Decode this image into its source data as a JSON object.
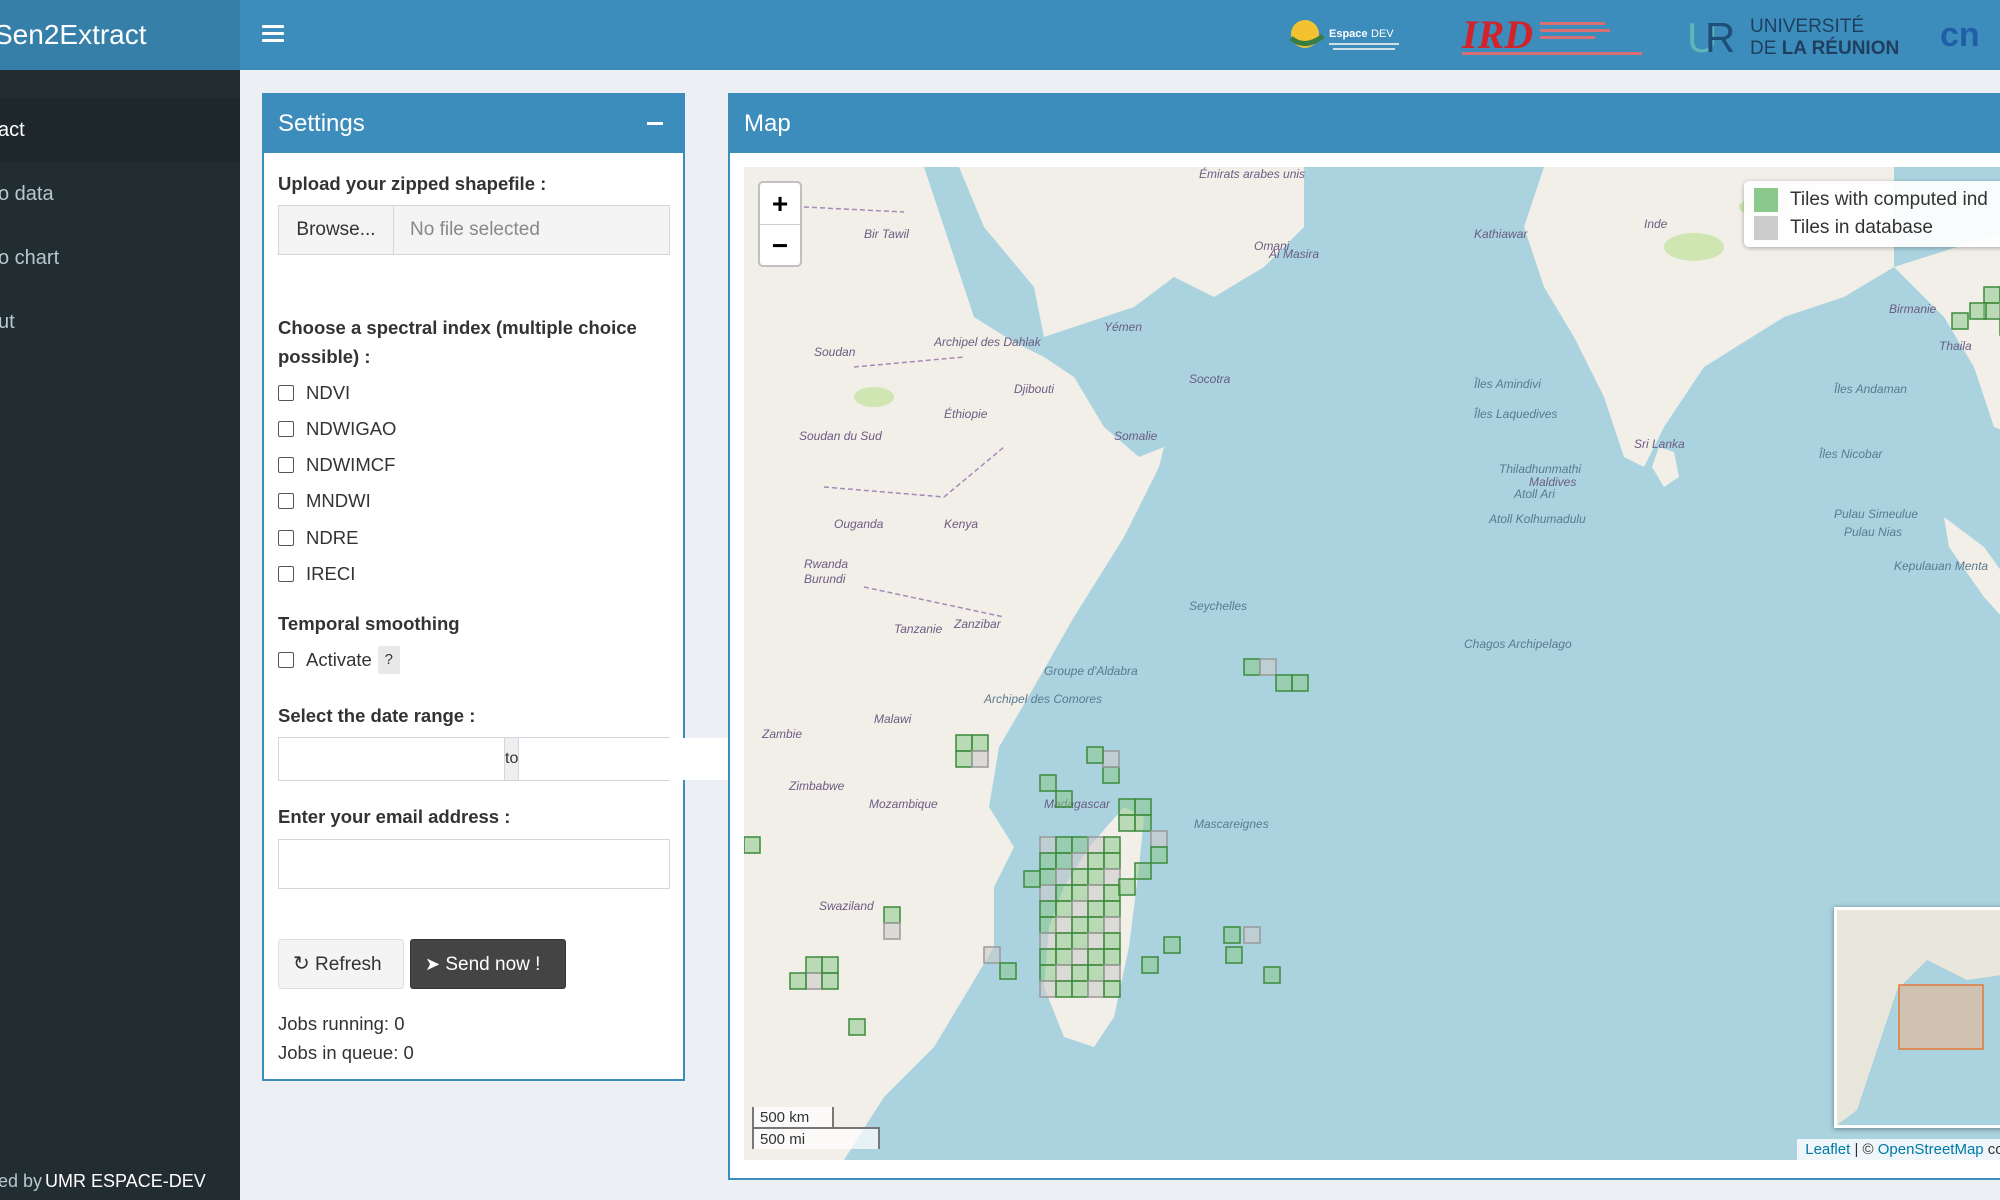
{
  "app": {
    "title": "Sen2Extract"
  },
  "sidebar": {
    "items": [
      {
        "label": "act",
        "active": true
      },
      {
        "label": "o data",
        "active": false
      },
      {
        "label": "o chart",
        "active": false
      },
      {
        "label": "ut",
        "active": false
      }
    ],
    "footer_prefix": "ed by ",
    "footer_org": "UMR ESPACE-DEV"
  },
  "header": {
    "partners": [
      "Espace DEV",
      "IRD",
      "Université de La Réunion",
      "CNES"
    ]
  },
  "settings": {
    "title": "Settings",
    "upload_label": "Upload your zipped shapefile :",
    "browse_label": "Browse...",
    "file_placeholder": "No file selected",
    "index_label": "Choose a spectral index (multiple choice possible) :",
    "indices": [
      "NDVI",
      "NDWIGAO",
      "NDWIMCF",
      "MNDWI",
      "NDRE",
      "IRECI"
    ],
    "smoothing_label": "Temporal smoothing",
    "activate_label": "Activate",
    "help_label": "?",
    "date_label": "Select the date range :",
    "date_separator": "to",
    "email_label": "Enter your email address :",
    "refresh_label": "Refresh",
    "send_label": "Send now !",
    "jobs_running": "Jobs running: 0",
    "jobs_queue": "Jobs in queue: 0"
  },
  "map": {
    "title": "Map",
    "zoom_in": "+",
    "zoom_out": "−",
    "legend": {
      "computed": "Tiles with computed ind",
      "database": "Tiles in database"
    },
    "colors": {
      "computed": "#8bc88b",
      "database": "#cccccc",
      "water": "#aad3df",
      "land": "#f2efe9"
    },
    "scale_km": "500 km",
    "scale_mi": "500 mi",
    "attribution_leaflet": "Leaflet",
    "attribution_sep": " | © ",
    "attribution_osm": "OpenStreetMap",
    "attribution_tail": " con",
    "places": [
      {
        "t": "Émirats arabes unis",
        "sea": false
      },
      {
        "t": "Omani",
        "sea": false
      },
      {
        "t": "Al Masira",
        "sea": false
      },
      {
        "t": "Bir Tawil",
        "sea": false
      },
      {
        "t": "Kathiawar",
        "sea": false
      },
      {
        "t": "Inde",
        "sea": false
      },
      {
        "t": "Archipel des Dahlak",
        "sea": false
      },
      {
        "t": "Yémen",
        "sea": false
      },
      {
        "t": "Soudan",
        "sea": false
      },
      {
        "t": "Djibouti",
        "sea": false
      },
      {
        "t": "Socotra",
        "sea": false
      },
      {
        "t": "Éthiopie",
        "sea": false
      },
      {
        "t": "Somalie",
        "sea": false
      },
      {
        "t": "Îles Amindivi",
        "sea": true
      },
      {
        "t": "Îles Laquedives",
        "sea": true
      },
      {
        "t": "Îles Andaman",
        "sea": true
      },
      {
        "t": "Soudan du Sud",
        "sea": false
      },
      {
        "t": "Sri Lanka",
        "sea": false
      },
      {
        "t": "Thiladhunmathi",
        "sea": true
      },
      {
        "t": "Maldives",
        "sea": false
      },
      {
        "t": "Atoll Ari",
        "sea": true
      },
      {
        "t": "Atoll Kolhumadulu",
        "sea": true
      },
      {
        "t": "Îles Nicobar",
        "sea": true
      },
      {
        "t": "Ouganda",
        "sea": false
      },
      {
        "t": "Kenya",
        "sea": false
      },
      {
        "t": "Rwanda",
        "sea": false
      },
      {
        "t": "Burundi",
        "sea": false
      },
      {
        "t": "Tanzanie",
        "sea": false
      },
      {
        "t": "Zanzibar",
        "sea": false
      },
      {
        "t": "Seychelles",
        "sea": true
      },
      {
        "t": "Chagos Archipelago",
        "sea": true
      },
      {
        "t": "Groupe d'Aldabra",
        "sea": true
      },
      {
        "t": "Archipel des Comores",
        "sea": true
      },
      {
        "t": "Malawi",
        "sea": false
      },
      {
        "t": "Zambie",
        "sea": false
      },
      {
        "t": "Zimbabwe",
        "sea": false
      },
      {
        "t": "Mozambique",
        "sea": false
      },
      {
        "t": "Madagascar",
        "sea": false
      },
      {
        "t": "Mascareignes",
        "sea": true
      },
      {
        "t": "Swaziland",
        "sea": false
      },
      {
        "t": "Pulau Simeulue",
        "sea": true
      },
      {
        "t": "Pulau Nias",
        "sea": true
      },
      {
        "t": "Kepulauan Menta",
        "sea": true
      },
      {
        "t": "Birmanie",
        "sea": false
      },
      {
        "t": "Thaila",
        "sea": false
      }
    ]
  }
}
